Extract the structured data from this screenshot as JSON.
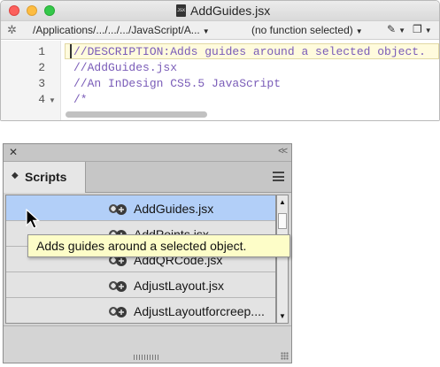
{
  "editor": {
    "window_title": "AddGuides.jsx",
    "doc_icon_text": "JSX",
    "toolbar": {
      "gear_icon": "gear-icon",
      "path": "/Applications/.../.../.../JavaScript/A...",
      "function_menu": "(no function selected)",
      "pen_icon": "pen-icon",
      "pages_icon": "pages-icon"
    },
    "line_numbers": [
      "1",
      "2",
      "3",
      "4"
    ],
    "code_lines": [
      "//DESCRIPTION:Adds guides around a selected object.",
      "//AddGuides.jsx",
      "//An InDesign CS5.5 JavaScript",
      "/*"
    ],
    "colors": {
      "comment": "#7a5cb8",
      "current_line": "#fffbdd"
    }
  },
  "scripts_panel": {
    "tab_label": "Scripts",
    "close_glyph": "✕",
    "collapse_glyph": "<<",
    "items": [
      {
        "label": "AddGuides.jsx",
        "icon": "script-icon",
        "selected": true
      },
      {
        "label": "AddPoints.jsx",
        "icon": "script-icon",
        "selected": false
      },
      {
        "label": "AddQRCode.jsx",
        "icon": "script-icon",
        "selected": false
      },
      {
        "label": "AdjustLayout.jsx",
        "icon": "script-icon",
        "selected": false
      },
      {
        "label": "AdjustLayoutforcreep....",
        "icon": "script-icon",
        "selected": false
      }
    ],
    "tooltip": "Adds guides around a selected object.",
    "colors": {
      "selected_row": "#b2cff8",
      "tooltip_bg": "#fdfdc8"
    }
  }
}
